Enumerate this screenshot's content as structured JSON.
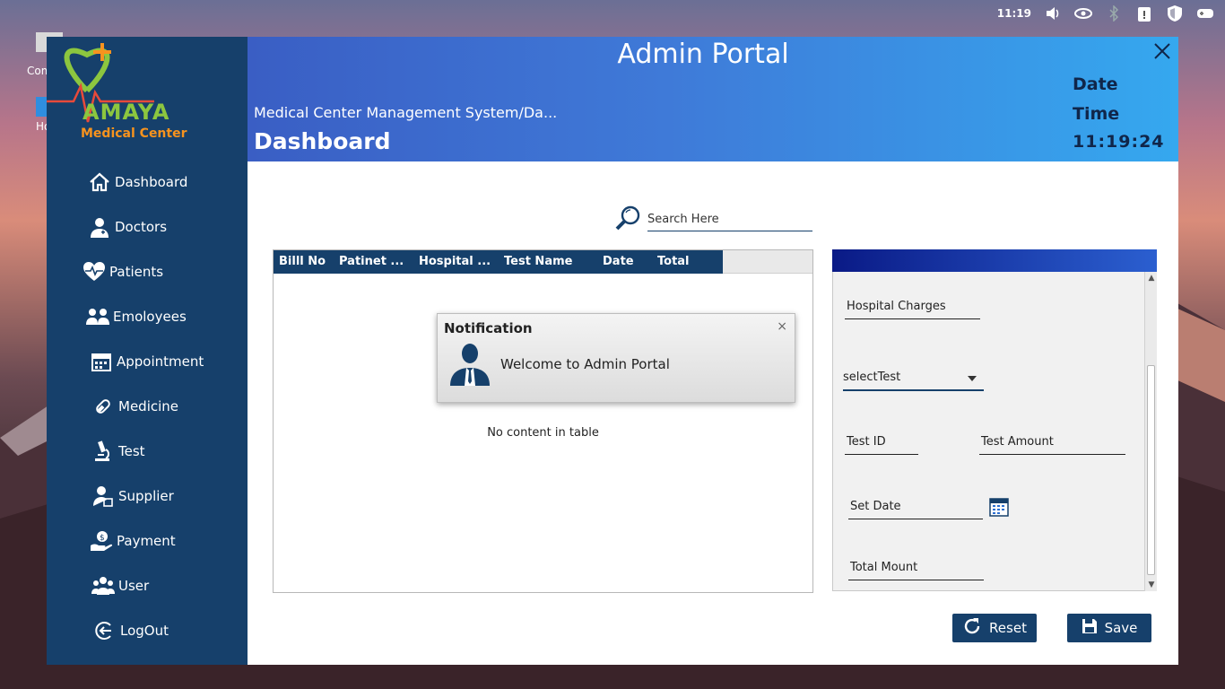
{
  "os": {
    "clock": "11:19",
    "desktop_icons": [
      "Com",
      "Ho"
    ]
  },
  "app": {
    "logo": {
      "brand": "AMAYA",
      "subtitle": "Medical Center"
    },
    "window_title": "Admin Portal",
    "breadcrumb": "Medical Center Management System/Da...",
    "page_title": "Dashboard",
    "date_label": "Date",
    "time_label": "Time",
    "time_value": "11:19:24"
  },
  "sidebar": {
    "items": [
      {
        "label": "Dashboard",
        "icon": "home-icon"
      },
      {
        "label": "Doctors",
        "icon": "doctor-icon"
      },
      {
        "label": "Patients",
        "icon": "heart-pulse-icon"
      },
      {
        "label": "Emoloyees",
        "icon": "employees-icon"
      },
      {
        "label": "Appointment",
        "icon": "calendar-icon"
      },
      {
        "label": "Medicine",
        "icon": "pill-icon"
      },
      {
        "label": "Test",
        "icon": "microscope-icon"
      },
      {
        "label": "Supplier",
        "icon": "supplier-icon"
      },
      {
        "label": "Payment",
        "icon": "payment-hand-icon"
      },
      {
        "label": "User",
        "icon": "users-icon"
      },
      {
        "label": "LogOut",
        "icon": "logout-icon"
      }
    ]
  },
  "search": {
    "placeholder": "Search Here"
  },
  "table": {
    "columns": [
      "Billl No",
      "Patinet ...",
      "Hospital ...",
      "Test Name",
      "Date",
      "Total"
    ],
    "empty_text": "No content in table"
  },
  "notification": {
    "title": "Notification",
    "message": "Welcome to Admin Portal",
    "close": "×"
  },
  "form": {
    "hospital_charges": "Hospital Charges",
    "select_test": "selectTest",
    "test_id": "Test ID",
    "test_amount": "Test Amount",
    "set_date": "Set Date",
    "total_amount": "Total Mount"
  },
  "buttons": {
    "reset": "Reset",
    "save": "Save"
  },
  "colors": {
    "sidebar": "#16406b",
    "header_start": "#3a5ec4",
    "header_end": "#35a8ef",
    "accent_green": "#8cc63f",
    "accent_orange": "#f7931e"
  }
}
